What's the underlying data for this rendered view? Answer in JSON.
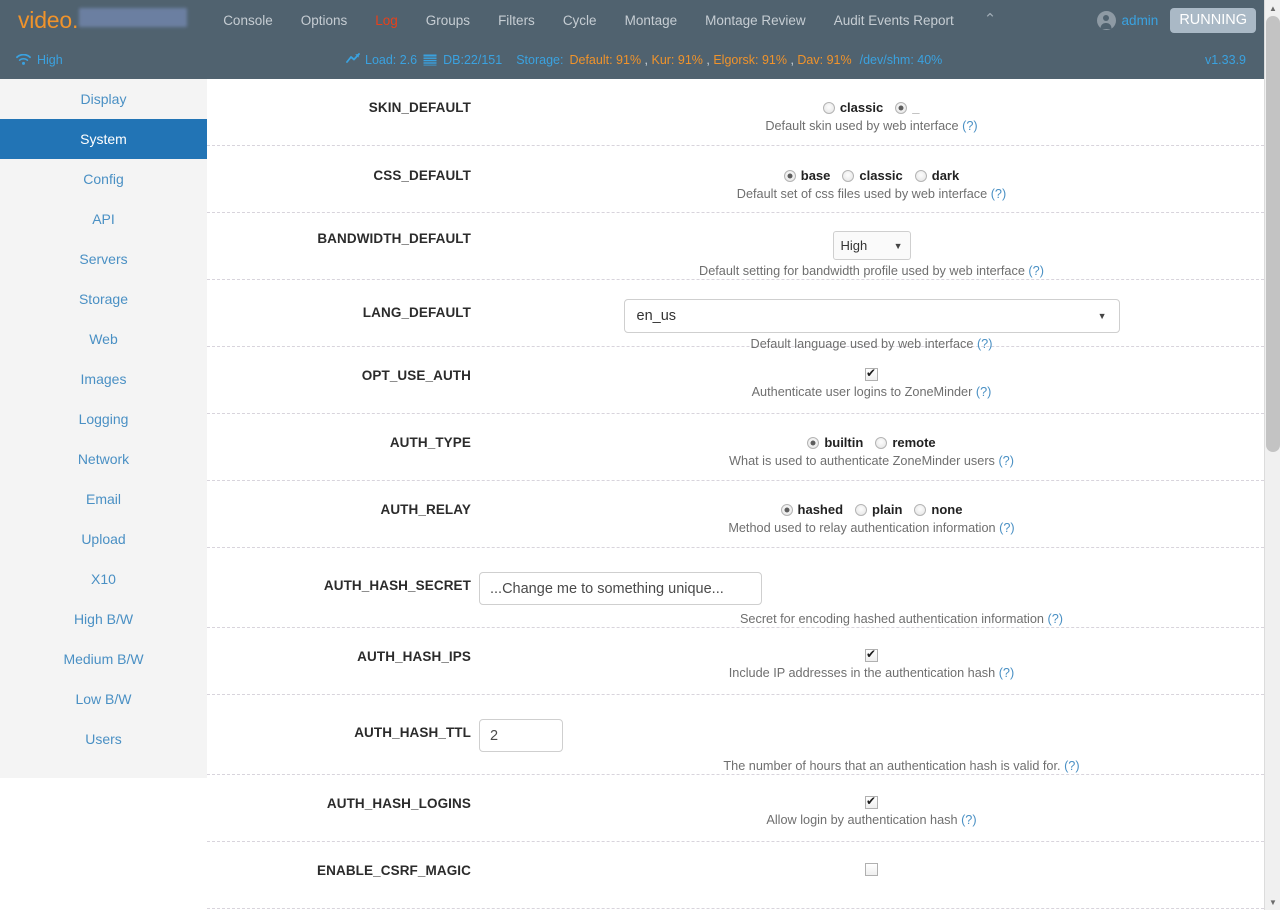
{
  "navbar": {
    "brand_text": "video.",
    "brand_redacted": "",
    "links": [
      {
        "label": "Console",
        "style": "normal"
      },
      {
        "label": "Options",
        "style": "normal"
      },
      {
        "label": "Log",
        "style": "red"
      },
      {
        "label": "Groups",
        "style": "normal"
      },
      {
        "label": "Filters",
        "style": "normal"
      },
      {
        "label": "Cycle",
        "style": "normal"
      },
      {
        "label": "Montage",
        "style": "normal"
      },
      {
        "label": "Montage Review",
        "style": "normal"
      },
      {
        "label": "Audit Events Report",
        "style": "normal"
      }
    ],
    "collapse_caret": "⌃",
    "user": "admin",
    "state_badge": "RUNNING",
    "accent_orange": "#f0932b",
    "accent_blue": "#3aa2e0",
    "accent_red": "#e8411a",
    "bar_bg": "#50626f"
  },
  "statusbar": {
    "bandwidth": "High",
    "load_label": "Load: 2.6",
    "db_label": "DB:22/151",
    "storage_label": "Storage:",
    "storage_items": [
      {
        "name": "Default:",
        "value": "91%"
      },
      {
        "name": "Kur:",
        "value": "91%"
      },
      {
        "name": "Elgorsk:",
        "value": "91%"
      },
      {
        "name": "Dav:",
        "value": "91%"
      }
    ],
    "shm_label": "/dev/shm: 40%",
    "version": "v1.33.9"
  },
  "sidebar": {
    "items": [
      {
        "label": "Display",
        "active": false
      },
      {
        "label": "System",
        "active": true
      },
      {
        "label": "Config",
        "active": false
      },
      {
        "label": "API",
        "active": false
      },
      {
        "label": "Servers",
        "active": false
      },
      {
        "label": "Storage",
        "active": false
      },
      {
        "label": "Web",
        "active": false
      },
      {
        "label": "Images",
        "active": false
      },
      {
        "label": "Logging",
        "active": false
      },
      {
        "label": "Network",
        "active": false
      },
      {
        "label": "Email",
        "active": false
      },
      {
        "label": "Upload",
        "active": false
      },
      {
        "label": "X10",
        "active": false
      },
      {
        "label": "High B/W",
        "active": false
      },
      {
        "label": "Medium B/W",
        "active": false
      },
      {
        "label": "Low B/W",
        "active": false
      },
      {
        "label": "Users",
        "active": false
      }
    ]
  },
  "options": [
    {
      "key": "SKIN_DEFAULT",
      "type": "radio",
      "choices": [
        {
          "label": "classic",
          "checked": false
        },
        {
          "label": "_",
          "checked": true
        }
      ],
      "hint": "Default skin used by web interface",
      "hint_q": "(?)"
    },
    {
      "key": "CSS_DEFAULT",
      "type": "radio",
      "choices": [
        {
          "label": "base",
          "checked": true
        },
        {
          "label": "classic",
          "checked": false
        },
        {
          "label": "dark",
          "checked": false
        }
      ],
      "hint": "Default set of css files used by web interface",
      "hint_q": "(?)"
    },
    {
      "key": "BANDWIDTH_DEFAULT",
      "type": "select-small",
      "value": "High",
      "hint": "Default setting for bandwidth profile used by web interface",
      "hint_q": "(?)"
    },
    {
      "key": "LANG_DEFAULT",
      "type": "select-wide",
      "value": "en_us",
      "hint": "Default language used by web interface",
      "hint_q": "(?)"
    },
    {
      "key": "OPT_USE_AUTH",
      "type": "checkbox",
      "checked": true,
      "hint": "Authenticate user logins to ZoneMinder",
      "hint_q": "(?)"
    },
    {
      "key": "AUTH_TYPE",
      "type": "radio",
      "choices": [
        {
          "label": "builtin",
          "checked": true
        },
        {
          "label": "remote",
          "checked": false
        }
      ],
      "hint": "What is used to authenticate ZoneMinder users",
      "hint_q": "(?)"
    },
    {
      "key": "AUTH_RELAY",
      "type": "radio",
      "choices": [
        {
          "label": "hashed",
          "checked": true
        },
        {
          "label": "plain",
          "checked": false
        },
        {
          "label": "none",
          "checked": false
        }
      ],
      "hint": "Method used to relay authentication information",
      "hint_q": "(?)"
    },
    {
      "key": "AUTH_HASH_SECRET",
      "type": "text-secret",
      "value": "...Change me to something unique...",
      "hint": "Secret for encoding hashed authentication information",
      "hint_q": "(?)"
    },
    {
      "key": "AUTH_HASH_IPS",
      "type": "checkbox",
      "checked": true,
      "hint": "Include IP addresses in the authentication hash",
      "hint_q": "(?)"
    },
    {
      "key": "AUTH_HASH_TTL",
      "type": "text-ttl",
      "value": "2",
      "hint": "The number of hours that an authentication hash is valid for.",
      "hint_q": "(?)"
    },
    {
      "key": "AUTH_HASH_LOGINS",
      "type": "checkbox",
      "checked": true,
      "hint": "Allow login by authentication hash",
      "hint_q": "(?)"
    },
    {
      "key": "ENABLE_CSRF_MAGIC",
      "type": "checkbox",
      "checked": false,
      "hint": "",
      "hint_q": ""
    }
  ],
  "scrollbar": {
    "up_arrow": "▲",
    "down_arrow": "▼"
  }
}
